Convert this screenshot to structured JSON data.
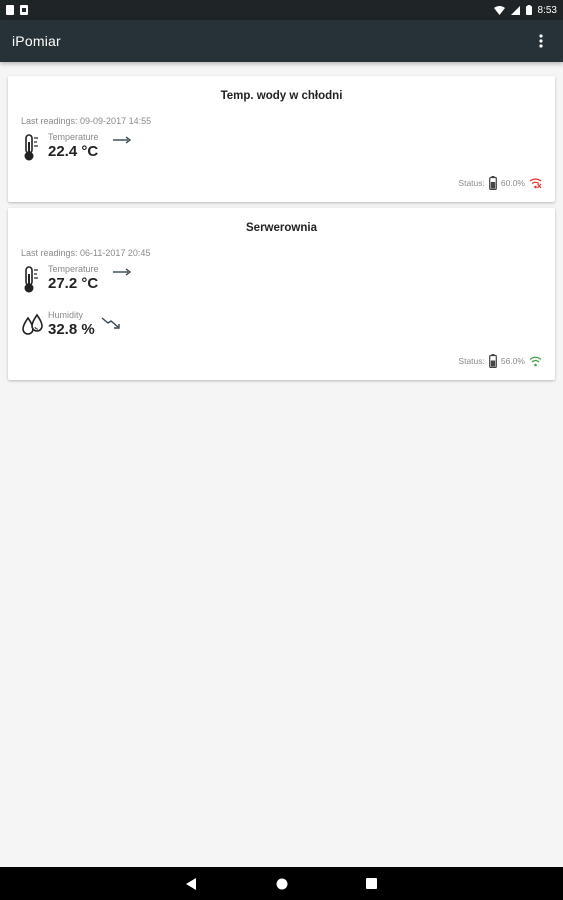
{
  "status_bar": {
    "time": "8:53",
    "icons": [
      "notification-icon",
      "notification-icon",
      "wifi-icon",
      "signal-icon",
      "battery-icon"
    ]
  },
  "app_bar": {
    "title": "iPomiar",
    "menu_icon": "overflow-menu-icon"
  },
  "cards": [
    {
      "title": "Temp. wody w chłodni",
      "last_readings": "Last readings: 09-09-2017 14:55",
      "readings": [
        {
          "label": "Temperature",
          "value": "22.4 °C",
          "icon": "thermometer-icon",
          "trend": "steady",
          "trend_color": "#37474f"
        }
      ],
      "status": {
        "label": "Status:",
        "battery_pct": "60.0%",
        "signal": "wifi-off",
        "signal_color": "#e53935"
      }
    },
    {
      "title": "Serwerownia",
      "last_readings": "Last readings: 06-11-2017 20:45",
      "readings": [
        {
          "label": "Temperature",
          "value": "27.2 °C",
          "icon": "thermometer-icon",
          "trend": "steady",
          "trend_color": "#37474f"
        },
        {
          "label": "Humidity",
          "value": "32.8 %",
          "icon": "humidity-icon",
          "trend": "falling",
          "trend_color": "#37474f"
        }
      ],
      "status": {
        "label": "Status:",
        "battery_pct": "56.0%",
        "signal": "wifi-on",
        "signal_color": "#43a047"
      }
    }
  ],
  "nav_bar": {
    "buttons": [
      "back-icon",
      "home-icon",
      "recents-icon"
    ]
  }
}
